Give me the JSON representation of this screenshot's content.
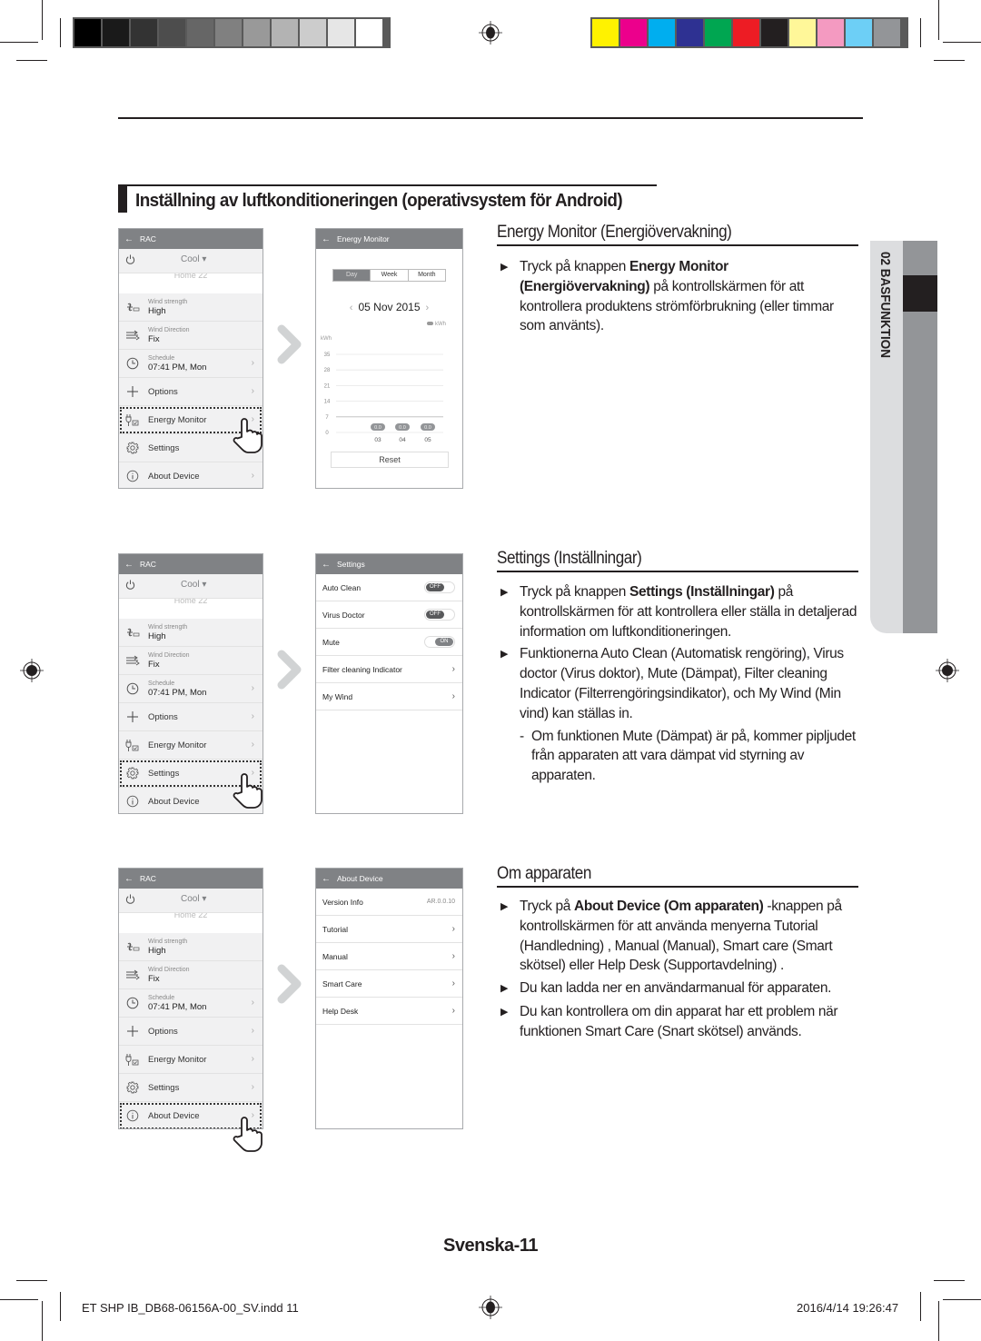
{
  "printer_marks": {
    "gray_bar": [
      "#000000",
      "#1a1a1a",
      "#333333",
      "#4d4d4d",
      "#666666",
      "#808080",
      "#999999",
      "#b3b3b3",
      "#cccccc",
      "#e6e6e6",
      "#ffffff"
    ],
    "color_bar": [
      "#fff200",
      "#ec008c",
      "#00aeef",
      "#2e3192",
      "#00a651",
      "#ed1c24",
      "#231f20",
      "#fff799",
      "#f49ac1",
      "#6dcff6",
      "#939598"
    ]
  },
  "heading": {
    "title": "Inställning av luftkonditioneringen (operativsystem för Android)"
  },
  "side_tab": {
    "label": "02  BASFUNKTION"
  },
  "rac_screen": {
    "header": "RAC",
    "back_icon": "arrow-left-icon",
    "mode": "Cool ▾",
    "home_partial": "Home 22",
    "wind_strength_label": "Wind strength",
    "wind_strength_value": "High",
    "wind_direction_label": "Wind Direction",
    "wind_direction_value": "Fix",
    "schedule_label": "Schedule",
    "schedule_value": "07:41 PM, Mon",
    "options": "Options",
    "energy_monitor": "Energy Monitor",
    "settings": "Settings",
    "about_device": "About Device",
    "chevron": "›"
  },
  "energy_screen": {
    "header": "Energy Monitor",
    "tabs": [
      "Day",
      "Week",
      "Month"
    ],
    "active_tab": "Day",
    "date": "05 Nov 2015",
    "prev": "‹",
    "next": "›",
    "legend": "kWh",
    "unit": "kWh",
    "reset": "Reset"
  },
  "chart_data": {
    "type": "bar",
    "title": "",
    "xlabel": "",
    "ylabel": "kWh",
    "categories": [
      "03",
      "04",
      "05"
    ],
    "values": [
      0.0,
      0.0,
      0.0
    ],
    "value_labels": [
      "0.0",
      "0.0",
      "0.0"
    ],
    "yticks": [
      0,
      7,
      14,
      21,
      28,
      35
    ],
    "ylim": [
      0,
      35
    ],
    "grid": true,
    "legend": "top-right"
  },
  "settings_screen": {
    "header": "Settings",
    "rows": [
      {
        "label": "Auto Clean",
        "toggle": "OFF"
      },
      {
        "label": "Virus Doctor",
        "toggle": "OFF"
      },
      {
        "label": "Mute",
        "toggle": "ON"
      },
      {
        "label": "Filter cleaning Indicator",
        "chevron": "›"
      },
      {
        "label": "My Wind",
        "chevron": "›"
      }
    ]
  },
  "about_screen": {
    "header": "About Device",
    "rows": [
      {
        "label": "Version Info",
        "value": "AR.0.0.10"
      },
      {
        "label": "Tutorial",
        "chevron": "›"
      },
      {
        "label": "Manual",
        "chevron": "›"
      },
      {
        "label": "Smart Care",
        "chevron": "›"
      },
      {
        "label": "Help Desk",
        "chevron": "›"
      }
    ]
  },
  "sections": {
    "energy": {
      "title": "Energy Monitor (Energiövervakning)",
      "b1_pre": "Tryck på knappen ",
      "b1_bold": "Energy Monitor (Energiövervakning)",
      "b1_post": " på kontrollskärmen för att kontrollera produktens strömförbrukning (eller timmar som använts)."
    },
    "settings": {
      "title": "Settings (Inställningar)",
      "b1_pre": "Tryck på knappen ",
      "b1_bold": "Settings (Inställningar)",
      "b1_post": " på kontrollskärmen för att kontrollera eller ställa in detaljerad information om luftkonditioneringen.",
      "b2": "Funktionerna Auto Clean (Automatisk rengöring), Virus doctor (Virus doktor), Mute (Dämpat), Filter cleaning Indicator (Filterrengöringsindikator), och My Wind (Min vind) kan ställas in.",
      "sub1": "Om funktionen Mute (Dämpat) är på, kommer pipljudet från apparaten att vara dämpat vid styrning av apparaten."
    },
    "about": {
      "title": "Om apparaten",
      "b1_pre": "Tryck på ",
      "b1_bold": "About Device (Om apparaten)",
      "b1_post": " -knappen på kontrollskärmen för att använda menyerna Tutorial (Handledning) , Manual (Manual), Smart care (Smart skötsel) eller Help Desk (Supportavdelning) .",
      "b2": "Du kan ladda ner en användarmanual för apparaten.",
      "b3": "Du kan kontrollera om din apparat har ett problem när funktionen Smart Care (Snart skötsel) används."
    },
    "bullet": "▶",
    "dash": "-"
  },
  "footer": {
    "page_label": "Svenska-11",
    "file": "ET SHP IB_DB68-06156A-00_SV.indd   11",
    "timestamp": "2016/4/14   19:26:47"
  }
}
